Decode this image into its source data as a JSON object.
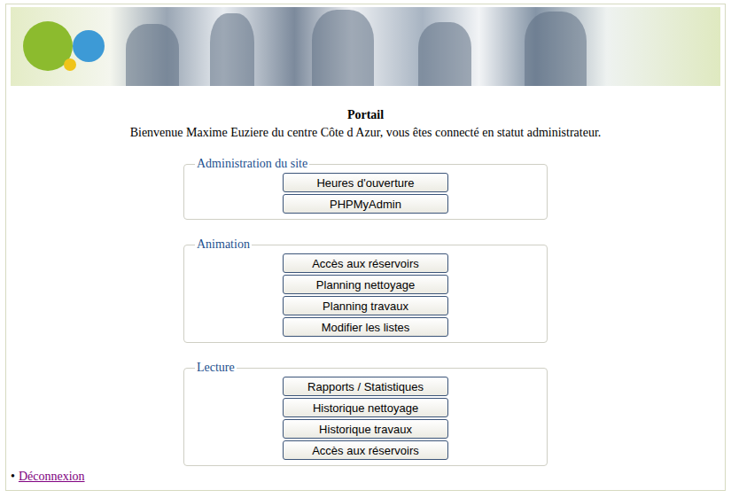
{
  "page": {
    "title": "Portail",
    "welcome": "Bienvenue Maxime Euziere du centre Côte d Azur, vous êtes connecté en statut administrateur."
  },
  "sections": [
    {
      "legend": "Administration du site",
      "buttons": [
        "Heures d'ouverture",
        "PHPMyAdmin"
      ]
    },
    {
      "legend": "Animation",
      "buttons": [
        "Accès aux réservoirs",
        "Planning nettoyage",
        "Planning travaux",
        "Modifier les listes"
      ]
    },
    {
      "legend": "Lecture",
      "buttons": [
        "Rapports / Statistiques",
        "Historique nettoyage",
        "Historique travaux",
        "Accès aux réservoirs"
      ]
    }
  ],
  "logout": {
    "bullet": "•",
    "label": "Déconnexion"
  }
}
